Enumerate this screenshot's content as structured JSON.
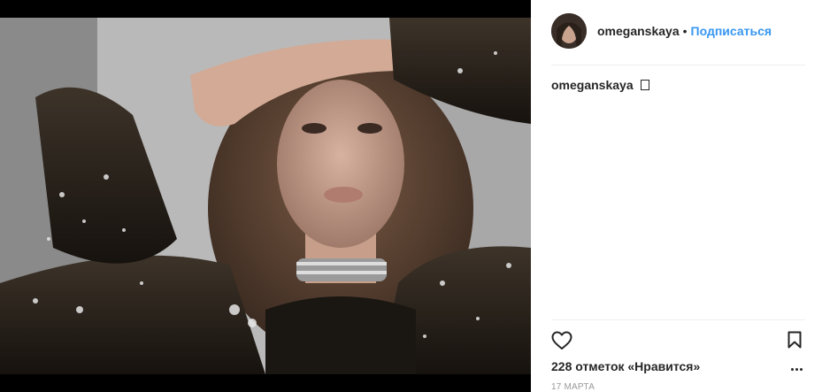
{
  "post": {
    "username": "omeganskaya",
    "separator": "•",
    "follow_label": "Подписаться",
    "caption": {
      "username": "omeganskaya",
      "emoji_placeholder": "▯"
    },
    "likes": {
      "count": "228",
      "label": "отметок «Нравится»"
    },
    "date": "17 МАРТА"
  },
  "icons": {
    "like": "heart-outline-icon",
    "save": "bookmark-outline-icon",
    "more": "more-horizontal-icon"
  },
  "colors": {
    "follow_blue": "#3897f0",
    "text_primary": "#262626",
    "text_secondary": "#999999",
    "divider": "#efefef"
  }
}
